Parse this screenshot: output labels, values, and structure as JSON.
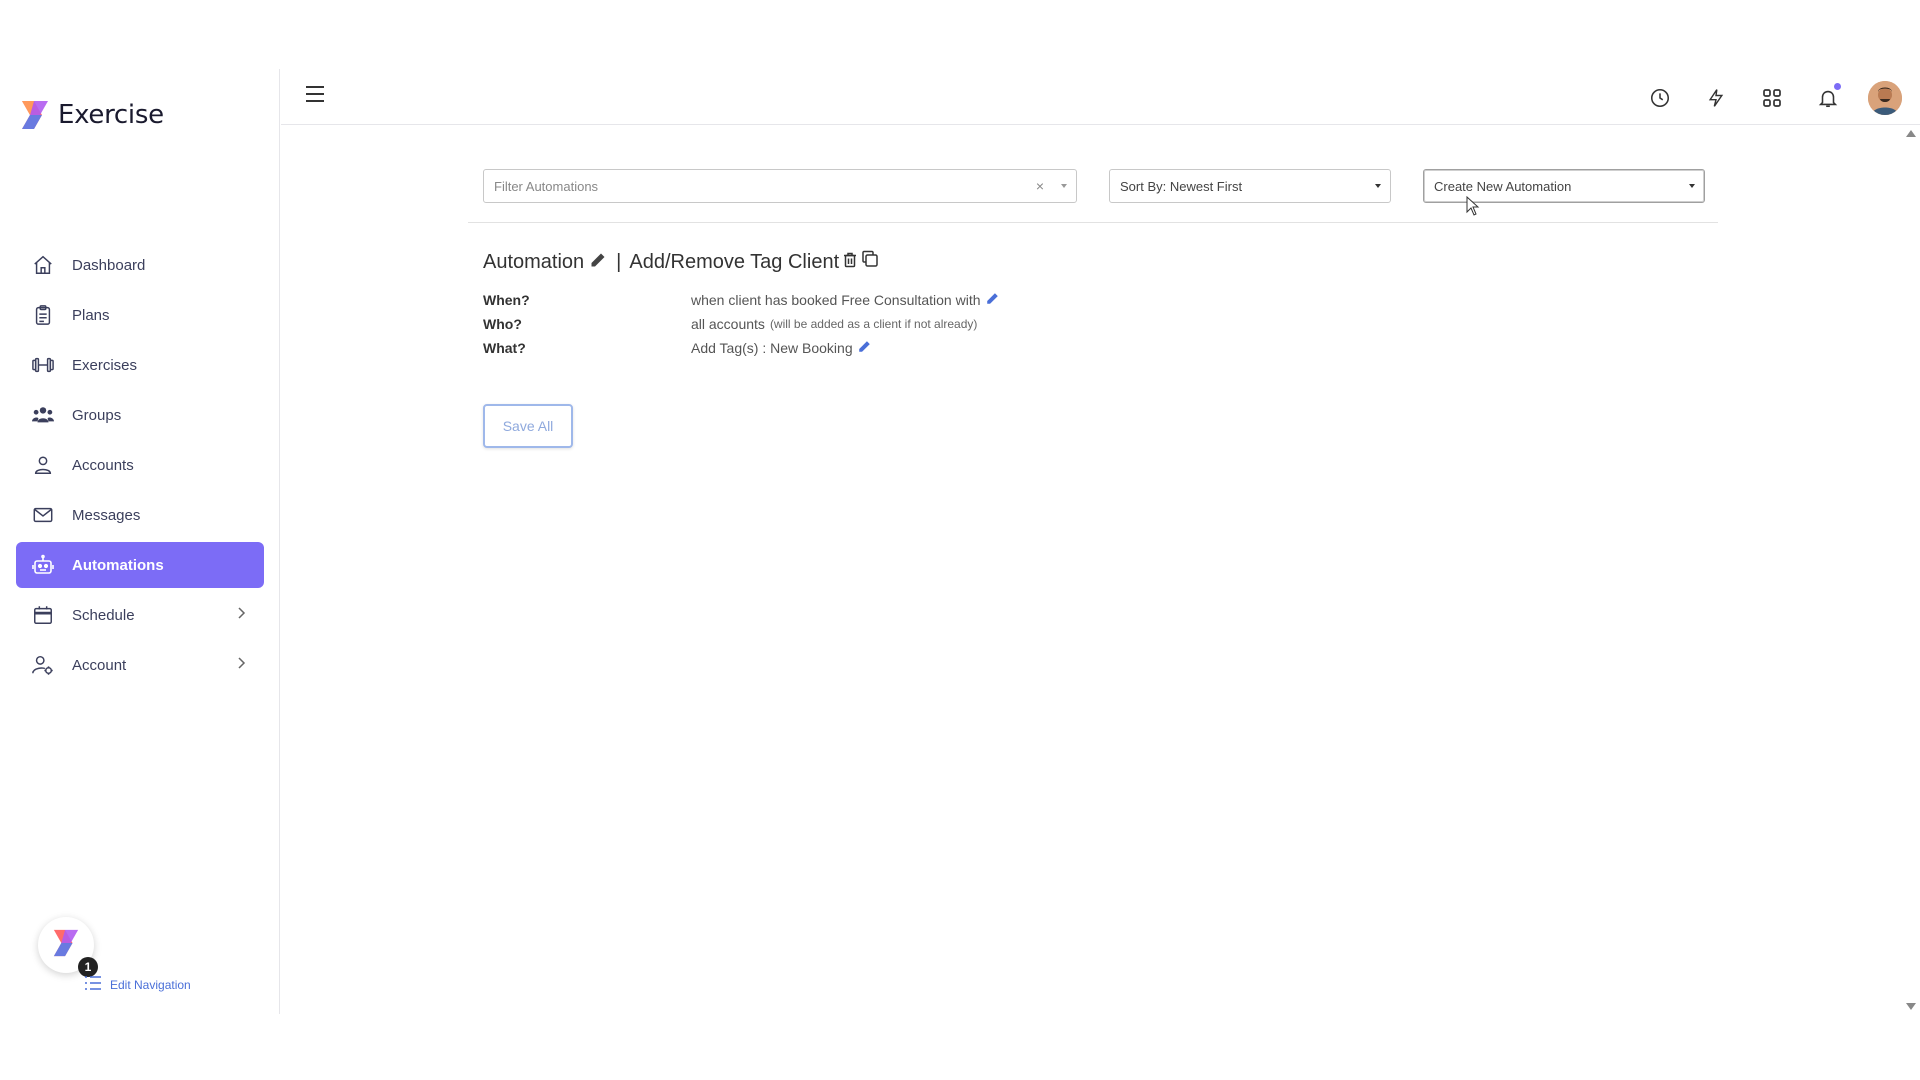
{
  "app": {
    "name": "Exercise"
  },
  "sidebar": {
    "items": [
      {
        "label": "Dashboard",
        "icon": "home-icon",
        "active": false
      },
      {
        "label": "Plans",
        "icon": "clipboard-icon",
        "active": false
      },
      {
        "label": "Exercises",
        "icon": "dumbbell-icon",
        "active": false
      },
      {
        "label": "Groups",
        "icon": "users-icon",
        "active": false
      },
      {
        "label": "Accounts",
        "icon": "user-icon",
        "active": false
      },
      {
        "label": "Messages",
        "icon": "mail-icon",
        "active": false
      },
      {
        "label": "Automations",
        "icon": "robot-icon",
        "active": true
      },
      {
        "label": "Schedule",
        "icon": "calendar-icon",
        "active": false,
        "has_submenu": true
      },
      {
        "label": "Account",
        "icon": "user-gear-icon",
        "active": false,
        "has_submenu": true
      }
    ],
    "badge_count": "1",
    "edit_navigation_label": "Edit Navigation"
  },
  "topbar": {
    "icons": [
      "history-icon",
      "lightning-icon",
      "apps-grid-icon",
      "bell-icon",
      "user-avatar"
    ]
  },
  "filters": {
    "filter_placeholder": "Filter Automations",
    "clear_symbol": "×",
    "sort_value": "Sort By: Newest First",
    "create_value": "Create New Automation"
  },
  "automation": {
    "title_prefix": "Automation",
    "separator": "|",
    "name": "Add/Remove Tag Client",
    "when_label": "When?",
    "when_value": "when client has booked Free Consultation with",
    "who_label": "Who?",
    "who_value": "all accounts",
    "who_note": "(will be added as a client if not already)",
    "what_label": "What?",
    "what_value": "Add Tag(s) : New Booking"
  },
  "actions": {
    "save_all": "Save All"
  },
  "colors": {
    "accent": "#7c6cf6",
    "link": "#4a6fd8",
    "save_border": "#9fb8ea"
  }
}
